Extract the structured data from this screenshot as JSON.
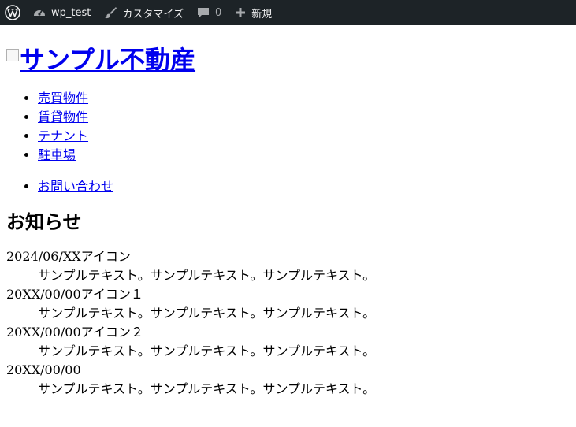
{
  "adminbar": {
    "site_name": "wp_test",
    "customize_label": "カスタマイズ",
    "comments_count": "0",
    "new_label": "新規"
  },
  "site": {
    "title": "サンプル不動産"
  },
  "nav": {
    "items": [
      {
        "label": "売買物件"
      },
      {
        "label": "賃貸物件"
      },
      {
        "label": "テナント"
      },
      {
        "label": "駐車場"
      }
    ],
    "contact": "お問い合わせ"
  },
  "news": {
    "heading": "お知らせ",
    "items": [
      {
        "date": "2024/06/XX",
        "icon": "アイコン",
        "text": "サンプルテキスト。サンプルテキスト。サンプルテキスト。"
      },
      {
        "date": "20XX/00/00",
        "icon": "アイコン１",
        "text": "サンプルテキスト。サンプルテキスト。サンプルテキスト。"
      },
      {
        "date": "20XX/00/00",
        "icon": "アイコン２",
        "text": "サンプルテキスト。サンプルテキスト。サンプルテキスト。"
      },
      {
        "date": "20XX/00/00",
        "icon": "",
        "text": "サンプルテキスト。サンプルテキスト。サンプルテキスト。"
      }
    ]
  },
  "colors": {
    "adminbar_bg": "#1d2327",
    "adminbar_text": "#f0f0f1",
    "link": "#0000ee"
  }
}
